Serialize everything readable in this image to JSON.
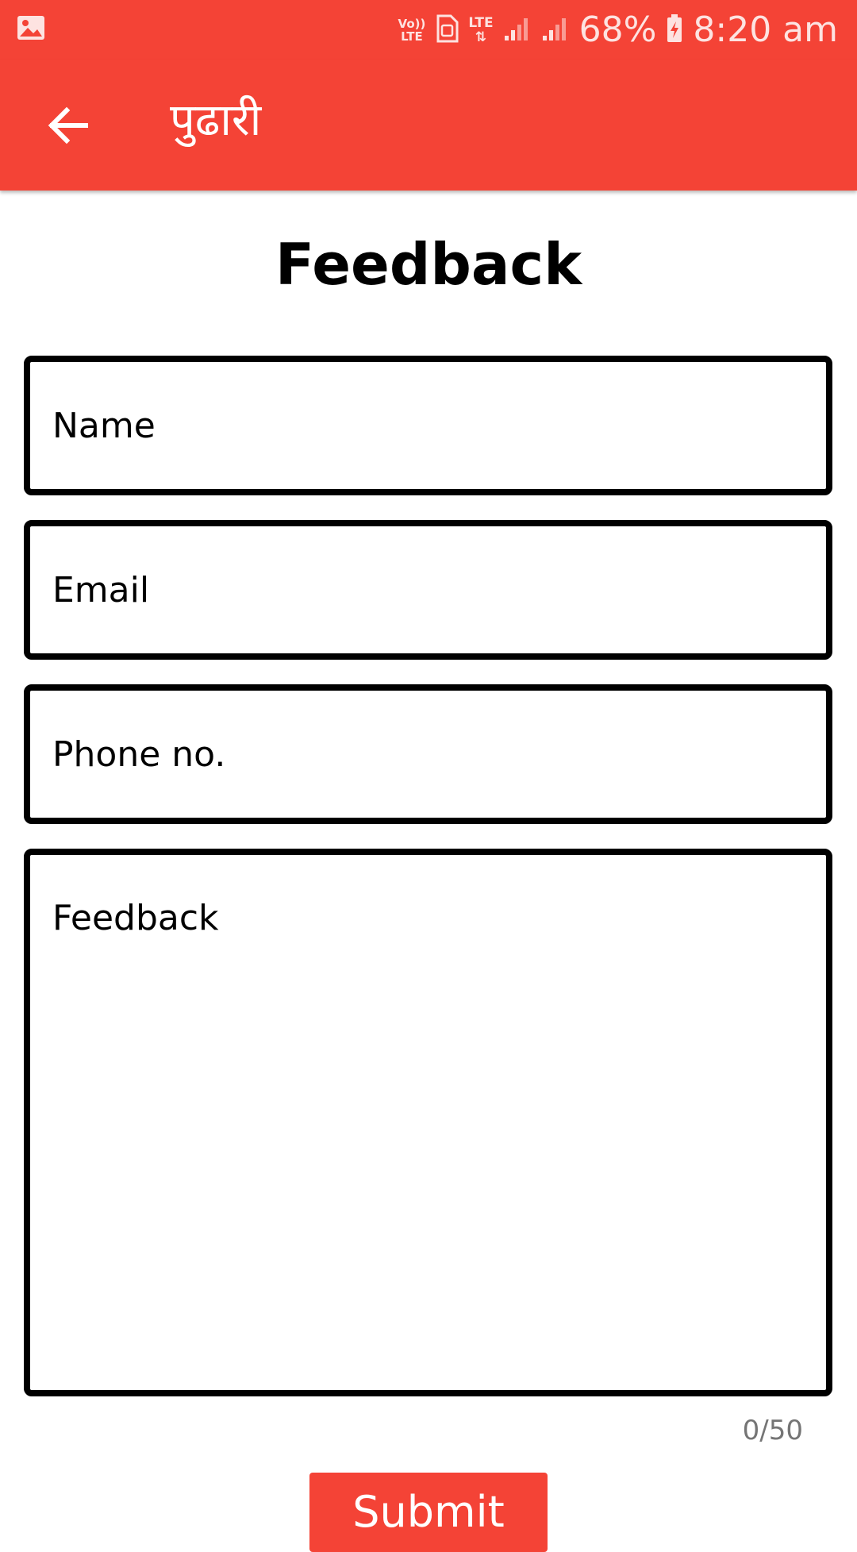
{
  "status_bar": {
    "volte_label_top": "Vo))",
    "volte_label_bottom": "LTE",
    "network_label": "LTE",
    "battery": "68%",
    "time": "8:20 am"
  },
  "app_bar": {
    "title": "पुढारी"
  },
  "page": {
    "title": "Feedback"
  },
  "form": {
    "name_placeholder": "Name",
    "email_placeholder": "Email",
    "phone_placeholder": "Phone no.",
    "feedback_placeholder": "Feedback",
    "char_counter": "0/50",
    "submit_label": "Submit"
  },
  "colors": {
    "brand": "#f44336",
    "text": "#000000",
    "muted": "#757575"
  }
}
